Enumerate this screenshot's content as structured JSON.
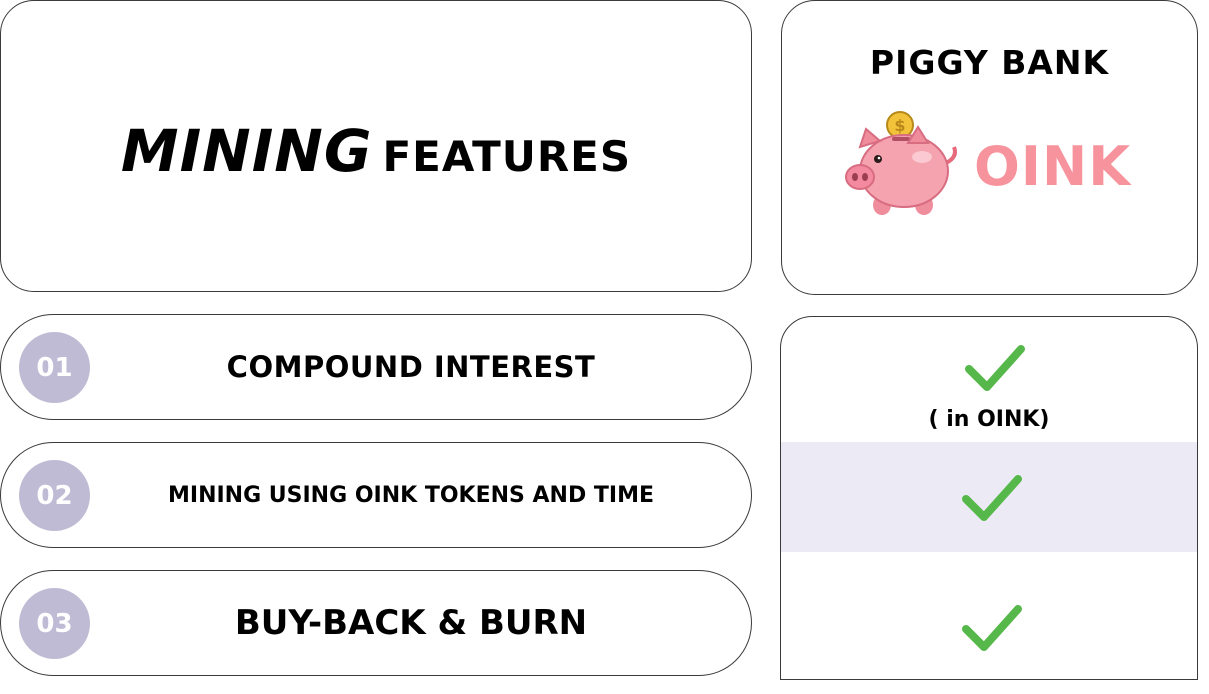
{
  "title": {
    "word1": "MINING",
    "word2": "FEATURES"
  },
  "piggy_bank": {
    "title": "PIGGY BANK",
    "token": "OINK",
    "token_color": "#f7939c",
    "icon": "piggy-bank-icon"
  },
  "features": [
    {
      "number": "01",
      "label": "COMPOUND INTEREST"
    },
    {
      "number": "02",
      "label": "MINING USING OINK TOKENS AND TIME"
    },
    {
      "number": "03",
      "label": "BUY-BACK & BURN"
    }
  ],
  "checks": {
    "icon": "checkmark-icon",
    "color": "#56b84a",
    "note": "( in OINK)"
  },
  "colors": {
    "number_circle": "#bfbbd5",
    "highlight_band": "#ecebf5",
    "border": "#3a3a3a"
  }
}
